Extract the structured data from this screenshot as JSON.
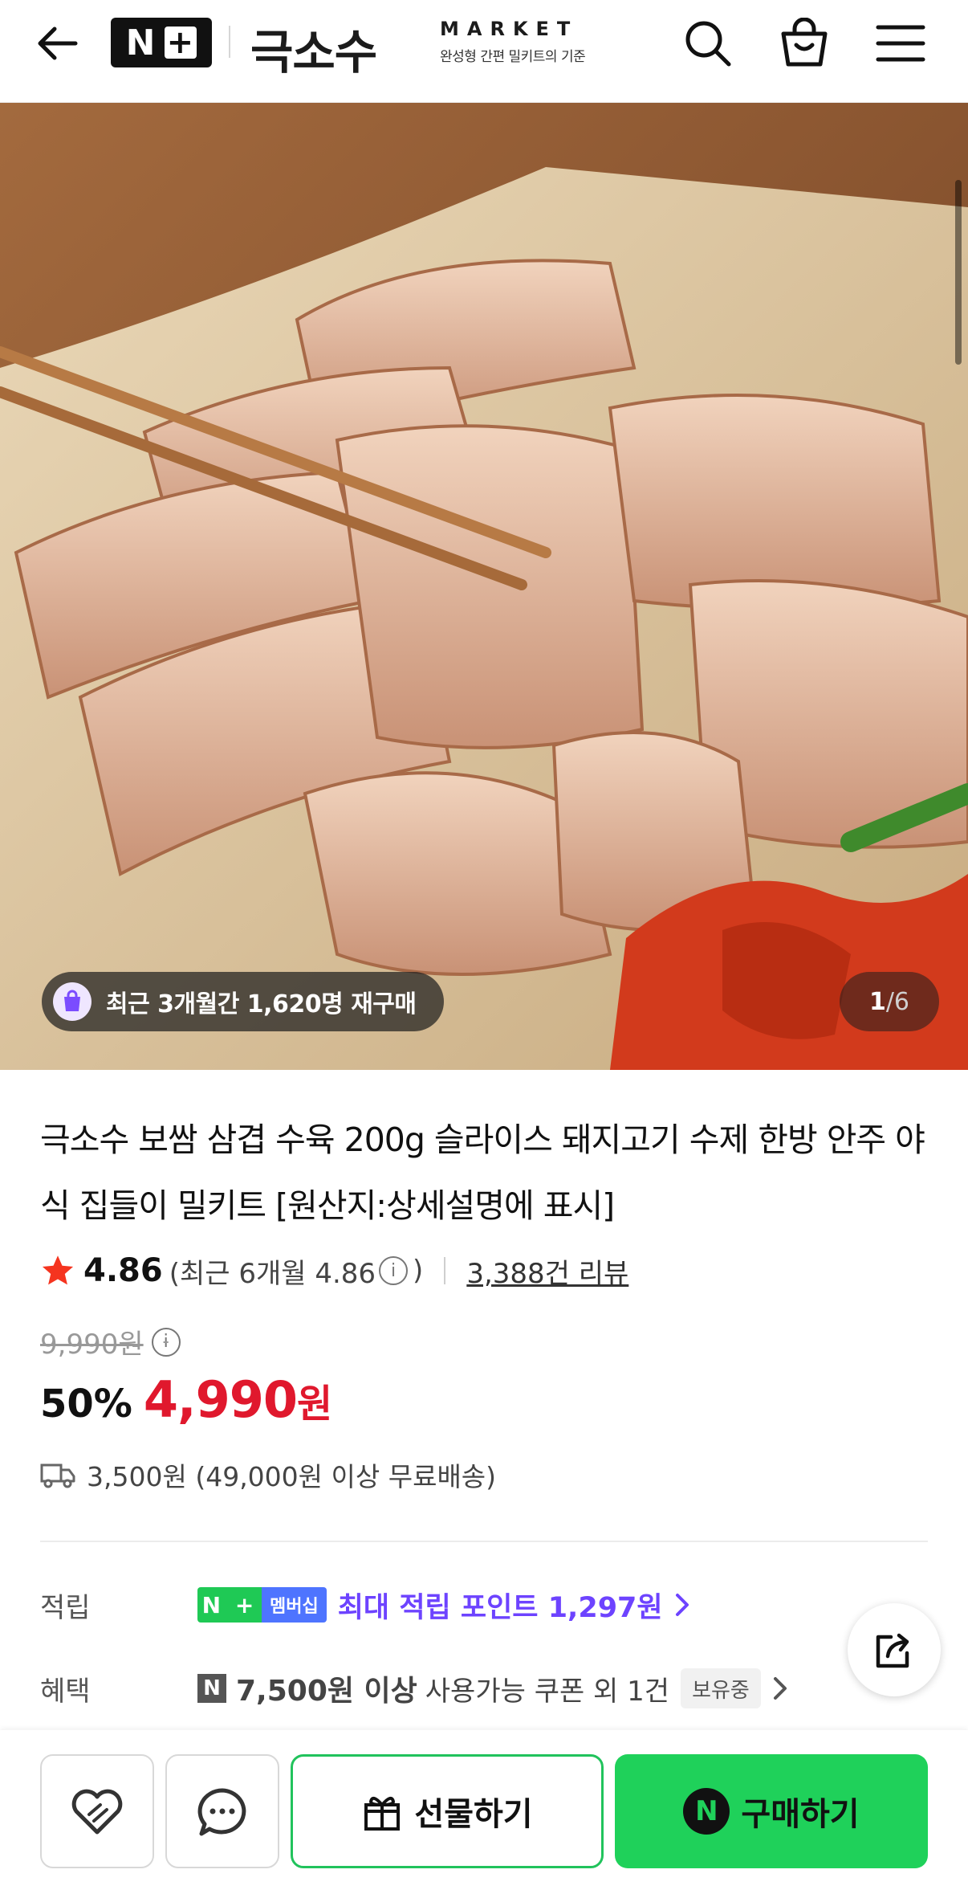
{
  "header": {
    "logo_text": "N",
    "logo_plus": "+",
    "brand_name": "극소수",
    "brand_market": "MARKET",
    "brand_tagline": "완성형 간편 밀키트의 기준",
    "icons": [
      "back-arrow-icon",
      "search-icon",
      "shopping-bag-icon",
      "menu-icon"
    ]
  },
  "hero": {
    "rebuy_badge": "최근 3개월간 1,620명 재구매",
    "image_index": "1",
    "image_total": "/6"
  },
  "product": {
    "title": "극소수 보쌈 삼겹 수육 200g 슬라이스 돼지고기 수제 한방 안주 야식 집들이 밀키트 [원산지:상세설명에 표시]",
    "rating": "4.86",
    "rating_recent_open": "(최근 6개월 4.86",
    "rating_recent_close": ")",
    "review_count": "3,388건 리뷰",
    "original_price": "9,990원",
    "discount_rate": "50%",
    "sale_price": "4,990",
    "sale_price_unit": "원",
    "shipping": "3,500원 (49,000원 이상 무료배송)"
  },
  "benefits": {
    "points_label": "적립",
    "membership_badge_n": "N",
    "membership_badge_plus": "+",
    "membership_badge_label": "멤버십",
    "points_text": "최대 적립 포인트 1,297원",
    "benefit_label": "혜택",
    "coupon_badge": "N",
    "coupon_bold": "7,500원 이상",
    "coupon_text": "사용가능 쿠폰 외 1건",
    "owned_tag": "보유중"
  },
  "bottom_bar": {
    "gift_label": "선물하기",
    "buy_label": "구매하기",
    "buy_badge": "N"
  },
  "colors": {
    "sale_red": "#e0182d",
    "points_purple": "#6d43ff",
    "buy_green": "#1fd15a",
    "membership_green": "#1fc955",
    "membership_blue": "#4e74ff"
  }
}
